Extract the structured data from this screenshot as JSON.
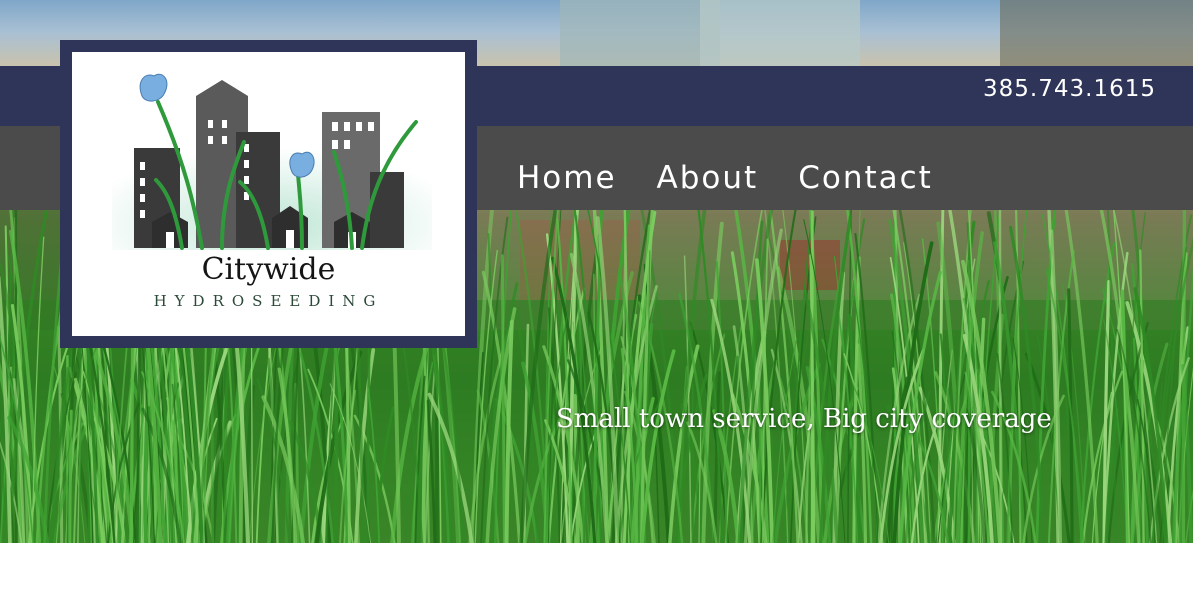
{
  "header": {
    "phone": "385.743.1615"
  },
  "nav": {
    "items": [
      {
        "label": "Home"
      },
      {
        "label": "About"
      },
      {
        "label": "Contact"
      }
    ]
  },
  "logo": {
    "title": "Citywide",
    "subtitle": "HYDROSEEDING"
  },
  "hero": {
    "tagline": "Small town service, Big city coverage"
  },
  "colors": {
    "topbar": "#2f3558",
    "navbar": "#4b4b4b",
    "grass": "#3f8a2c"
  }
}
